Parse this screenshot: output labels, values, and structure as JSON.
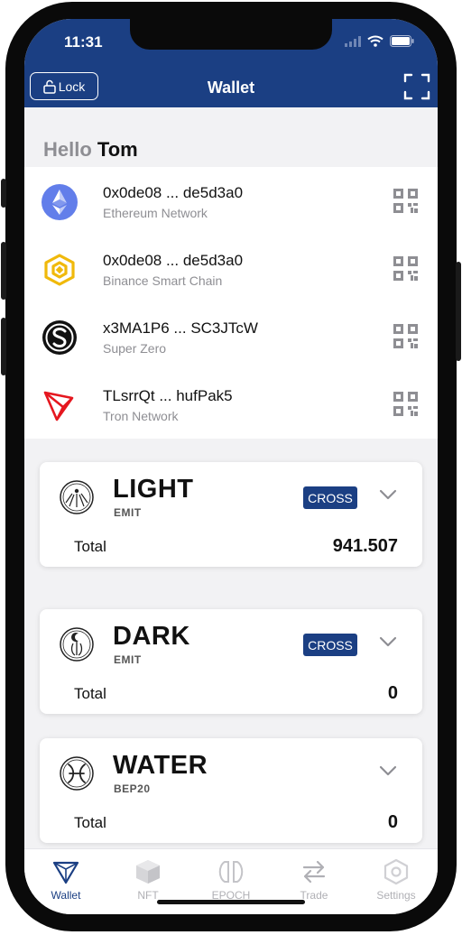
{
  "status_bar": {
    "time": "11:31"
  },
  "header": {
    "lock_label": "Lock",
    "title": "Wallet"
  },
  "greeting": {
    "hello": "Hello",
    "name": "Tom"
  },
  "networks": [
    {
      "address": "0x0de08 ... de5d3a0",
      "network": "Ethereum Network",
      "icon": "ethereum-icon"
    },
    {
      "address": "0x0de08 ... de5d3a0",
      "network": "Binance Smart Chain",
      "icon": "binance-icon"
    },
    {
      "address": "x3MA1P6 ... SC3JTcW",
      "network": "Super Zero",
      "icon": "super-zero-icon"
    },
    {
      "address": "TLsrrQt ... hufPak5",
      "network": "Tron Network",
      "icon": "tron-icon"
    }
  ],
  "tokens": [
    {
      "name": "LIGHT",
      "standard": "EMIT",
      "badge": "CROSS",
      "total_label": "Total",
      "total": "941.507"
    },
    {
      "name": "DARK",
      "standard": "EMIT",
      "badge": "CROSS",
      "total_label": "Total",
      "total": "0"
    },
    {
      "name": "WATER",
      "standard": "BEP20",
      "total_label": "Total",
      "total": "0"
    }
  ],
  "tabs": [
    {
      "label": "Wallet",
      "icon": "wallet-icon",
      "active": true
    },
    {
      "label": "NFT",
      "icon": "cube-icon",
      "active": false
    },
    {
      "label": "EPOCH",
      "icon": "epoch-icon",
      "active": false
    },
    {
      "label": "Trade",
      "icon": "swap-arrows-icon",
      "active": false
    },
    {
      "label": "Settings",
      "icon": "gear-icon",
      "active": false
    }
  ],
  "colors": {
    "brand": "#1b3f83",
    "background": "#f2f2f4",
    "muted": "#8e8e93"
  }
}
